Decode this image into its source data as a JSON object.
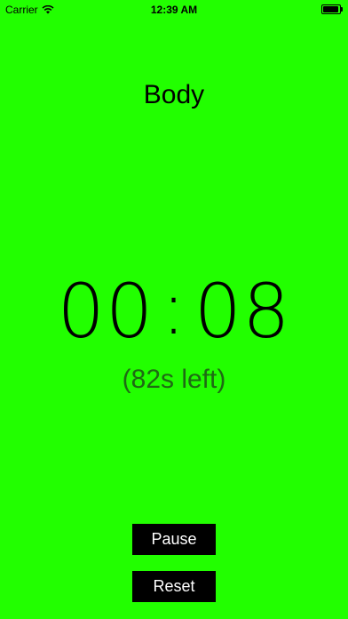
{
  "status_bar": {
    "carrier": "Carrier",
    "time": "12:39 AM",
    "wifi_icon": "wifi-icon",
    "battery_icon": "battery-icon"
  },
  "workout": {
    "title": "Body"
  },
  "timer": {
    "minutes": "00",
    "separator": ":",
    "seconds": "08",
    "remaining": "(82s left)"
  },
  "controls": {
    "pause_label": "Pause",
    "reset_label": "Reset"
  },
  "colors": {
    "background": "#22ff00",
    "button_bg": "#000000",
    "button_text": "#ffffff"
  }
}
